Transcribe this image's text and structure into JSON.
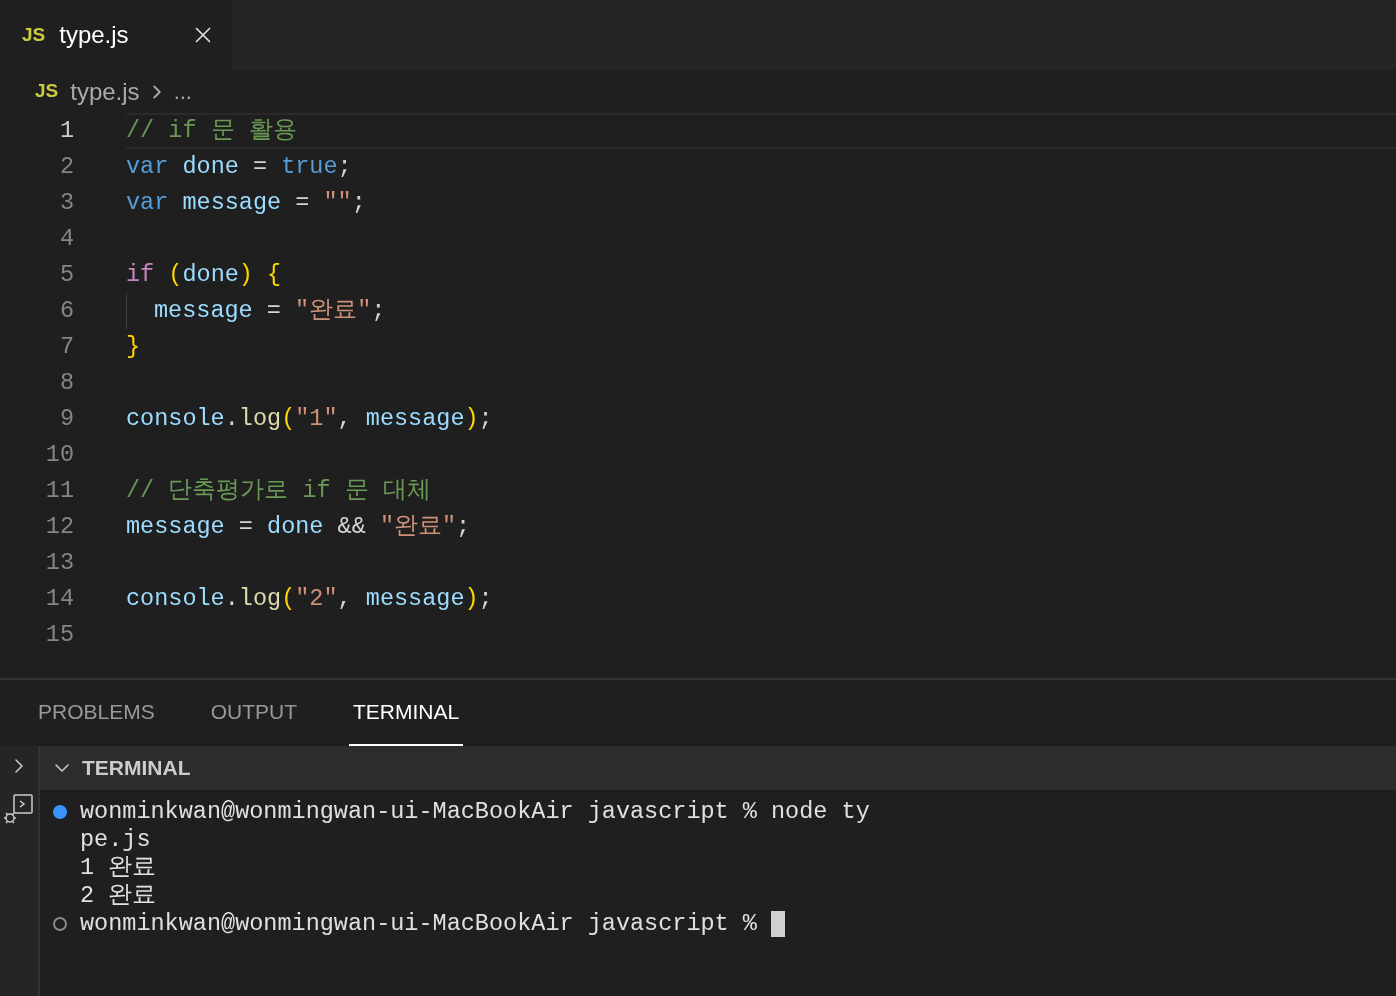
{
  "tabs": [
    {
      "label": "type.js",
      "icon": "JS",
      "selected": true
    }
  ],
  "breadcrumb": {
    "icon": "JS",
    "file": "type.js",
    "rest": "..."
  },
  "editor": {
    "lines": [
      {
        "number": "1",
        "active": true,
        "indent_guide": false,
        "tokens": [
          {
            "t": "// if 문 활용",
            "kind": "comment"
          }
        ]
      },
      {
        "number": "2",
        "active": false,
        "indent_guide": false,
        "tokens": [
          {
            "t": "var ",
            "kind": "keyword"
          },
          {
            "t": "done",
            "kind": "variable"
          },
          {
            "t": " = ",
            "kind": "plain"
          },
          {
            "t": "true",
            "kind": "keyword"
          },
          {
            "t": ";",
            "kind": "plain"
          }
        ]
      },
      {
        "number": "3",
        "active": false,
        "indent_guide": false,
        "tokens": [
          {
            "t": "var ",
            "kind": "keyword"
          },
          {
            "t": "message",
            "kind": "variable"
          },
          {
            "t": " = ",
            "kind": "plain"
          },
          {
            "t": "\"\"",
            "kind": "string"
          },
          {
            "t": ";",
            "kind": "plain"
          }
        ]
      },
      {
        "number": "4",
        "active": false,
        "indent_guide": false
      },
      {
        "number": "5",
        "active": false,
        "indent_guide": false,
        "tokens": [
          {
            "t": "if ",
            "kind": "control"
          },
          {
            "t": "(",
            "kind": "bracket"
          },
          {
            "t": "done",
            "kind": "variable"
          },
          {
            "t": ") {",
            "kind": "bracket"
          }
        ]
      },
      {
        "number": "6",
        "active": false,
        "indent_guide": true,
        "tokens": [
          {
            "t": "message",
            "kind": "variable"
          },
          {
            "t": " = ",
            "kind": "plain"
          },
          {
            "t": "\"완료\"",
            "kind": "string"
          },
          {
            "t": ";",
            "kind": "plain"
          }
        ]
      },
      {
        "number": "7",
        "active": false,
        "indent_guide": false,
        "tokens": [
          {
            "t": "}",
            "kind": "bracket"
          }
        ]
      },
      {
        "number": "8",
        "active": false,
        "indent_guide": false
      },
      {
        "number": "9",
        "active": false,
        "indent_guide": false,
        "tokens": [
          {
            "t": "console",
            "kind": "variable"
          },
          {
            "t": ".",
            "kind": "plain"
          },
          {
            "t": "log",
            "kind": "function"
          },
          {
            "t": "(",
            "kind": "bracket"
          },
          {
            "t": "\"1\"",
            "kind": "string"
          },
          {
            "t": ", ",
            "kind": "plain"
          },
          {
            "t": "message",
            "kind": "variable"
          },
          {
            "t": ")",
            "kind": "bracket"
          },
          {
            "t": ";",
            "kind": "plain"
          }
        ]
      },
      {
        "number": "10",
        "active": false,
        "indent_guide": false
      },
      {
        "number": "11",
        "active": false,
        "indent_guide": false,
        "tokens": [
          {
            "t": "// 단축평가로 if 문 대체",
            "kind": "comment"
          }
        ]
      },
      {
        "number": "12",
        "active": false,
        "indent_guide": false,
        "tokens": [
          {
            "t": "message",
            "kind": "variable"
          },
          {
            "t": " = ",
            "kind": "plain"
          },
          {
            "t": "done",
            "kind": "variable"
          },
          {
            "t": " && ",
            "kind": "plain"
          },
          {
            "t": "\"완료\"",
            "kind": "string"
          },
          {
            "t": ";",
            "kind": "plain"
          }
        ]
      },
      {
        "number": "13",
        "active": false,
        "indent_guide": false
      },
      {
        "number": "14",
        "active": false,
        "indent_guide": false,
        "tokens": [
          {
            "t": "console",
            "kind": "variable"
          },
          {
            "t": ".",
            "kind": "plain"
          },
          {
            "t": "log",
            "kind": "function"
          },
          {
            "t": "(",
            "kind": "bracket"
          },
          {
            "t": "\"2\"",
            "kind": "string"
          },
          {
            "t": ", ",
            "kind": "plain"
          },
          {
            "t": "message",
            "kind": "variable"
          },
          {
            "t": ")",
            "kind": "bracket"
          },
          {
            "t": ";",
            "kind": "plain"
          }
        ]
      },
      {
        "number": "15",
        "active": false,
        "indent_guide": false
      }
    ]
  },
  "panel": {
    "tabs": [
      {
        "label": "PROBLEMS",
        "selected": false
      },
      {
        "label": "OUTPUT",
        "selected": false
      },
      {
        "label": "TERMINAL",
        "selected": true
      }
    ],
    "section_title": "TERMINAL",
    "section_expanded": true,
    "terminal_lines": [
      {
        "kind": "success",
        "text": "wonminkwan@wonmingwan-ui-MacBookAir javascript % node ty",
        "cursor": false
      },
      {
        "kind": "output",
        "text": "pe.js",
        "cursor": false
      },
      {
        "kind": "output",
        "text": "1 완료",
        "cursor": false
      },
      {
        "kind": "output",
        "text": "2 완료",
        "cursor": false
      },
      {
        "kind": "idle",
        "text": "wonminkwan@wonmingwan-ui-MacBookAir javascript %",
        "cursor": true
      }
    ]
  }
}
